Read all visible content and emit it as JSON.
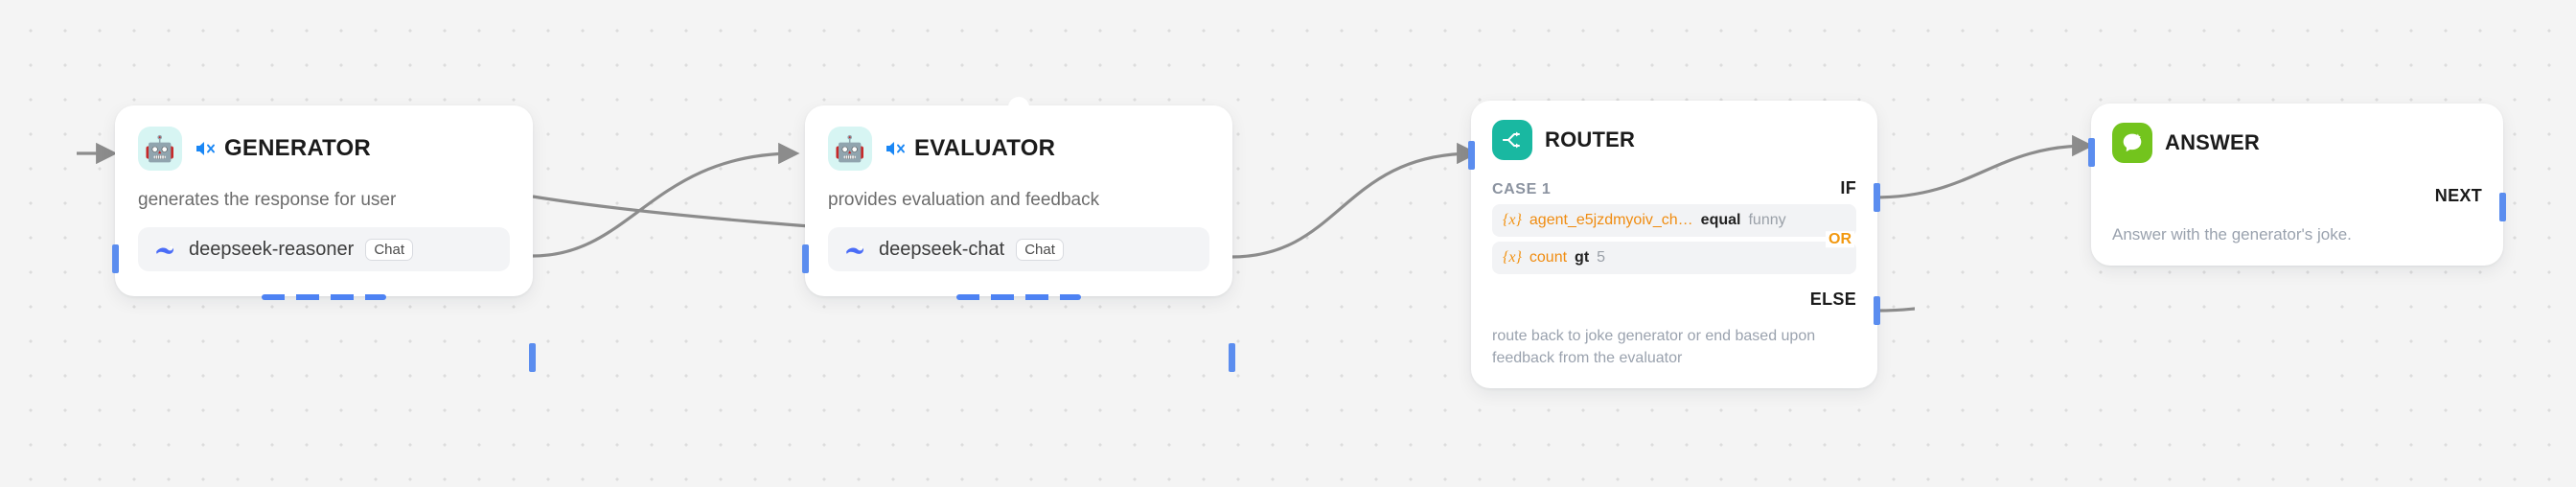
{
  "canvas": {
    "background_color": "#f4f4f4",
    "dot_color": "#dcdcdc",
    "edge_color": "#8c8c8c",
    "port_color": "#5b8def"
  },
  "nodes": {
    "generator": {
      "icon": "robot-emoji-icon",
      "emoji": "🤖",
      "mute_icon": "speaker-muted-icon",
      "title": "GENERATOR",
      "description": "generates the response for user",
      "model": {
        "provider_icon": "deepseek-whale-icon",
        "name": "deepseek-reasoner",
        "badge": "Chat"
      },
      "running": true
    },
    "evaluator": {
      "icon": "robot-emoji-icon",
      "emoji": "🤖",
      "mute_icon": "speaker-muted-icon",
      "title": "EVALUATOR",
      "description": "provides evaluation and feedback",
      "model": {
        "provider_icon": "deepseek-whale-icon",
        "name": "deepseek-chat",
        "badge": "Chat"
      },
      "running": true
    },
    "router": {
      "icon": "router-split-icon",
      "icon_color": "#19b8a1",
      "title": "ROUTER",
      "case_label": "CASE 1",
      "if_label": "IF",
      "else_label": "ELSE",
      "operator": "OR",
      "conditions": [
        {
          "variable_glyph": "{x}",
          "variable": "agent_e5jzdmyoiv_ch…",
          "operator": "equal",
          "value": "funny"
        },
        {
          "variable_glyph": "{x}",
          "variable": "count",
          "operator": "gt",
          "value": "5"
        }
      ],
      "description": "route back to joke generator or end based upon feedback from the evaluator"
    },
    "answer": {
      "icon": "answer-bubble-icon",
      "icon_color": "#73c41d",
      "title": "ANSWER",
      "next_label": "NEXT",
      "description": "Answer with the generator's joke."
    }
  }
}
